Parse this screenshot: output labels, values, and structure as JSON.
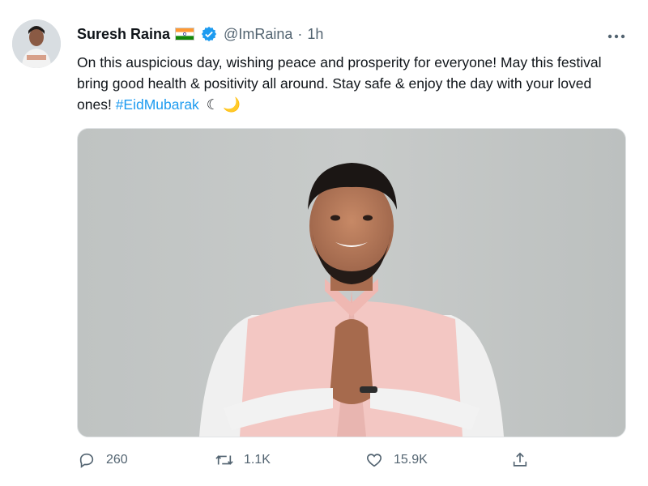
{
  "tweet": {
    "author_name": "Suresh Raina",
    "handle": "@ImRaina",
    "separator": "·",
    "time": "1h",
    "text_main": "On this auspicious day, wishing peace and prosperity for everyone! May this festival bring good health & positivity all around. Stay safe & enjoy the day with your loved ones!",
    "hashtag": "#EidMubarak",
    "emoji": "☾ 🌙"
  },
  "icons": {
    "flag": "indian-flag-icon",
    "verified": "verified-badge-icon",
    "more": "more-icon",
    "reply": "reply-icon",
    "retweet": "retweet-icon",
    "like": "like-icon",
    "share": "share-icon"
  },
  "actions": {
    "reply_count": "260",
    "retweet_count": "1.1K",
    "like_count": "15.9K"
  },
  "colors": {
    "accent": "#1d9bf0",
    "secondary_text": "#536471",
    "primary_text": "#0f1419"
  }
}
